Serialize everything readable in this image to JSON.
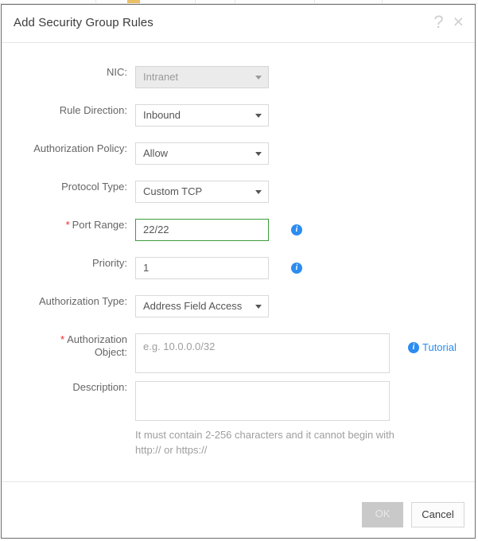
{
  "dialog": {
    "title": "Add Security Group Rules",
    "help_icon": "?",
    "close_icon": "×"
  },
  "form": {
    "rows": [
      {
        "label": "NIC:",
        "required": false,
        "control": "select",
        "value": "Intranet",
        "disabled": true,
        "info": false
      },
      {
        "label": "Rule Direction:",
        "required": false,
        "control": "select",
        "value": "Inbound",
        "disabled": false,
        "info": false
      },
      {
        "label": "Authorization Policy:",
        "required": false,
        "control": "select",
        "value": "Allow",
        "disabled": false,
        "info": false
      },
      {
        "label": "Protocol Type:",
        "required": false,
        "control": "select",
        "value": "Custom TCP",
        "disabled": false,
        "info": false
      },
      {
        "label": "Port Range:",
        "required": true,
        "control": "input",
        "value": "22/22",
        "valid": true,
        "info": true
      },
      {
        "label": "Priority:",
        "required": true,
        "control": "input",
        "value": "1",
        "valid": false,
        "info": true
      },
      {
        "label": "Authorization Type:",
        "required": false,
        "control": "select",
        "value": "Address Field Access",
        "disabled": false,
        "info": false
      },
      {
        "label_line1": "Authorization",
        "label_line2": "Object:",
        "required": true,
        "control": "textarea",
        "placeholder": "e.g. 10.0.0.0/32",
        "value": "",
        "link": "Tutorial"
      },
      {
        "label": "Description:",
        "required": false,
        "control": "textarea",
        "placeholder": "",
        "value": "",
        "hint": "It must contain 2-256 characters and it cannot begin with http:// or https://"
      }
    ],
    "required_marker": "*",
    "info_glyph": "i"
  },
  "footer": {
    "ok_label": "OK",
    "cancel_label": "Cancel"
  },
  "colors": {
    "link": "#2d8cf0",
    "valid_border": "#3c9c3c",
    "required": "#f5232b"
  }
}
